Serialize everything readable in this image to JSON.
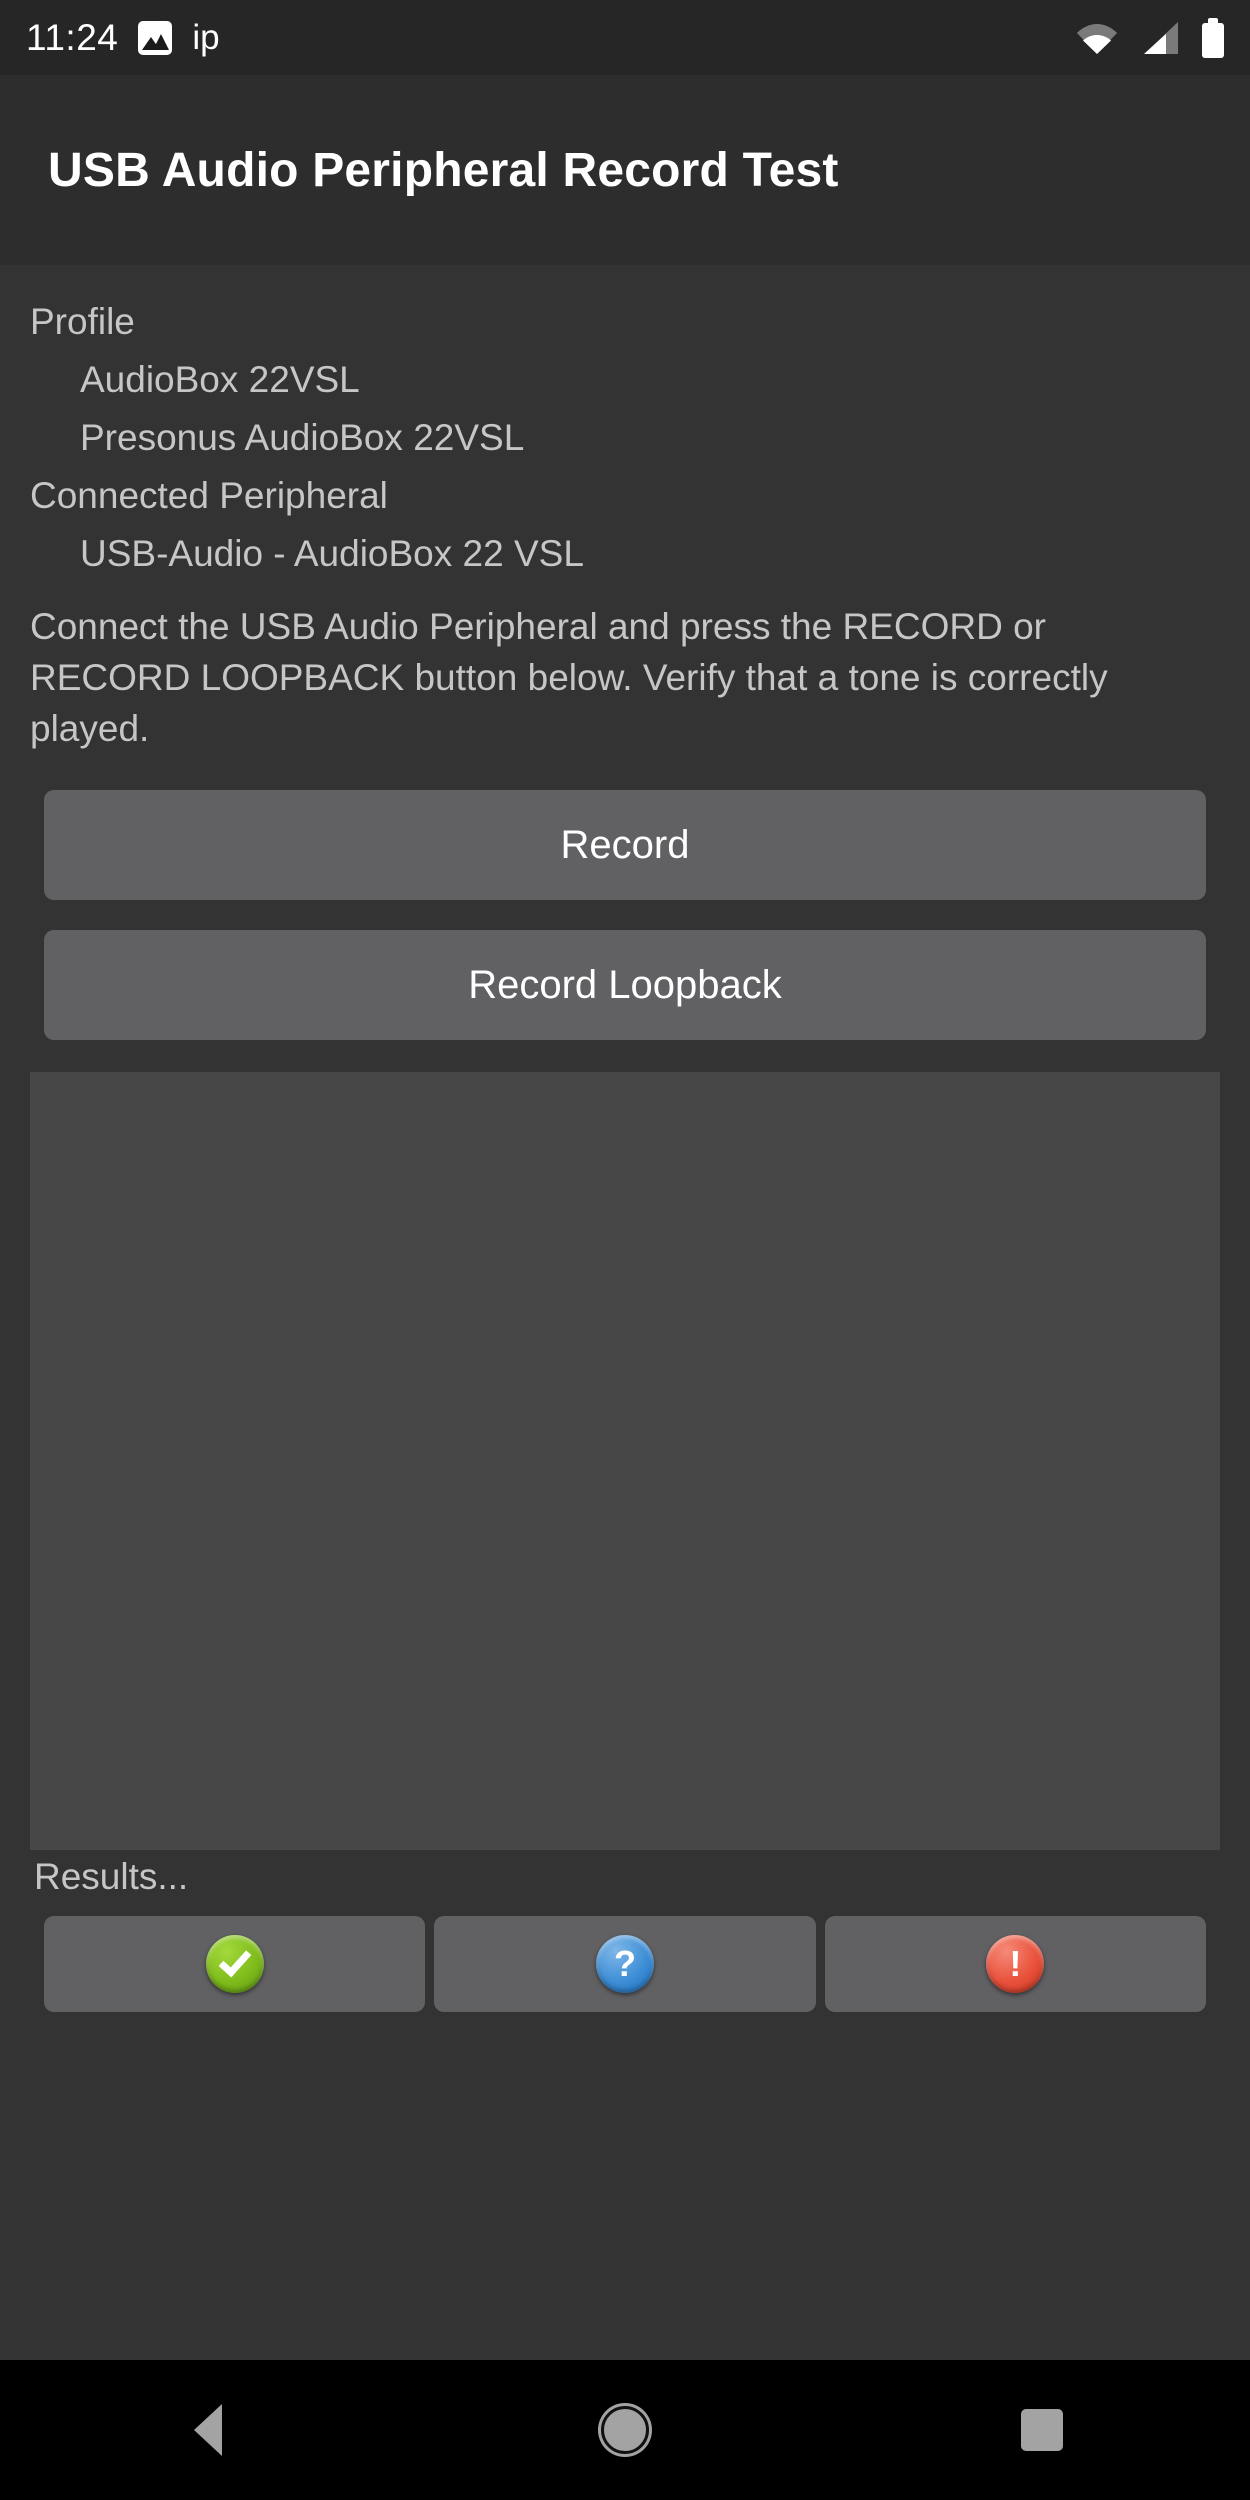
{
  "status_bar": {
    "time": "11:24",
    "notification_icon": "photo-icon",
    "notification_text": "ip",
    "right_icons": [
      "wifi-icon",
      "cellular-signal-icon",
      "battery-icon"
    ]
  },
  "app_bar": {
    "title": "USB Audio Peripheral Record Test"
  },
  "info": {
    "profile_label": "Profile",
    "profile_name": "AudioBox 22VSL",
    "profile_product": "Presonus AudioBox 22VSL",
    "connected_label": "Connected Peripheral",
    "connected_device": "USB-Audio - AudioBox 22 VSL"
  },
  "instructions": {
    "text": "Connect the USB Audio Peripheral and press the RECORD or RECORD LOOPBACK button below. Verify that a tone is correctly played."
  },
  "actions": {
    "record_label": "Record",
    "record_loopback_label": "Record Loopback"
  },
  "wave_display": {
    "content": ""
  },
  "results": {
    "label": "Results...",
    "buttons": [
      {
        "name": "pass",
        "icon": "check-circle-icon",
        "glyph": "",
        "color": "#7fbc1b"
      },
      {
        "name": "info",
        "icon": "question-circle-icon",
        "glyph": "?",
        "color": "#3d8ed6"
      },
      {
        "name": "fail",
        "icon": "exclamation-circle-icon",
        "glyph": "!",
        "color": "#e9513b"
      }
    ]
  },
  "nav_bar": {
    "back_label": "Back",
    "home_label": "Home",
    "recents_label": "Recents"
  },
  "colors": {
    "background": "#333333",
    "app_bar": "#2d2d2d",
    "status_bar": "#262626",
    "button": "#616164",
    "wave_area": "#474747",
    "text_primary": "#ffffff",
    "text_secondary": "#c6c6c6",
    "nav_bar": "#000000"
  }
}
